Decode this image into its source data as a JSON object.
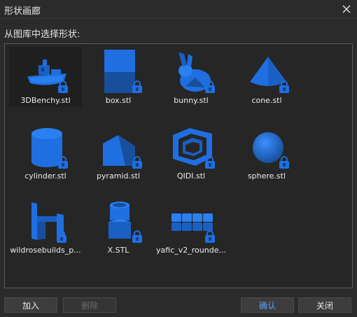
{
  "window": {
    "title": "形状画廊"
  },
  "prompt": "从图库中选择形状:",
  "items": [
    {
      "label": "3DBenchy.stl",
      "icon": "benchy-model-icon",
      "locked": true
    },
    {
      "label": "box.stl",
      "icon": "box-model-icon",
      "locked": true
    },
    {
      "label": "bunny.stl",
      "icon": "bunny-model-icon",
      "locked": true
    },
    {
      "label": "cone.stl",
      "icon": "cone-model-icon",
      "locked": true
    },
    {
      "label": "cylinder.stl",
      "icon": "cylinder-model-icon",
      "locked": true
    },
    {
      "label": "pyramid.stl",
      "icon": "pyramid-model-icon",
      "locked": true
    },
    {
      "label": "QIDI.stl",
      "icon": "qidi-model-icon",
      "locked": true
    },
    {
      "label": "sphere.stl",
      "icon": "sphere-model-icon",
      "locked": true
    },
    {
      "label": "wildrosebuilds_p...",
      "icon": "wildrose-model-icon",
      "locked": true
    },
    {
      "label": "X.STL",
      "icon": "x-model-icon",
      "locked": true
    },
    {
      "label": "yafic_v2_rounde...",
      "icon": "yafic-model-icon",
      "locked": true
    }
  ],
  "buttons": {
    "add": "加入",
    "delete": "删除",
    "confirm": "确认",
    "close": "关闭"
  },
  "colors": {
    "model_blue": "#1f6fe0",
    "accent_text": "#5aa0ff"
  }
}
